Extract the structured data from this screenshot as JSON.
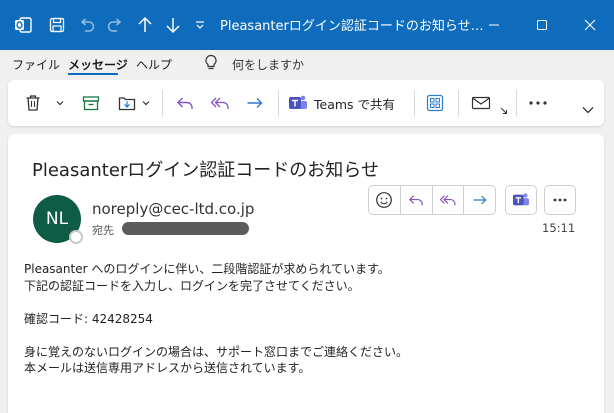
{
  "window": {
    "title": "Pleasanterログイン認証コードのお知らせ…"
  },
  "menu": {
    "items": [
      "ファイル",
      "メッセージ",
      "ヘルプ"
    ],
    "active": "メッセージ",
    "search_placeholder": "何をしますか"
  },
  "ribbon": {
    "teams_share_label": "Teams で共有"
  },
  "message": {
    "subject": "Pleasanterログイン認証コードのお知らせ",
    "avatar_initials": "NL",
    "sender": "noreply@cec-ltd.co.jp",
    "to_label": "宛先",
    "time": "15:11",
    "body": [
      "Pleasanter へのログインに伴い、二段階認証が求められています。",
      "下記の認証コードを入力し、ログインを完了させてください。",
      "",
      "確認コード: 42428254",
      "",
      "身に覚えのないログインの場合は、サポート窓口までご連絡ください。",
      "本メールは送信専用アドレスから送信されています。"
    ]
  },
  "colors": {
    "titlebar": "#0f6cbd",
    "avatar": "#0e5c45",
    "icon_purple": "#8a4fc7",
    "icon_blue": "#2b7bd0",
    "teams": "#4b53bc"
  }
}
